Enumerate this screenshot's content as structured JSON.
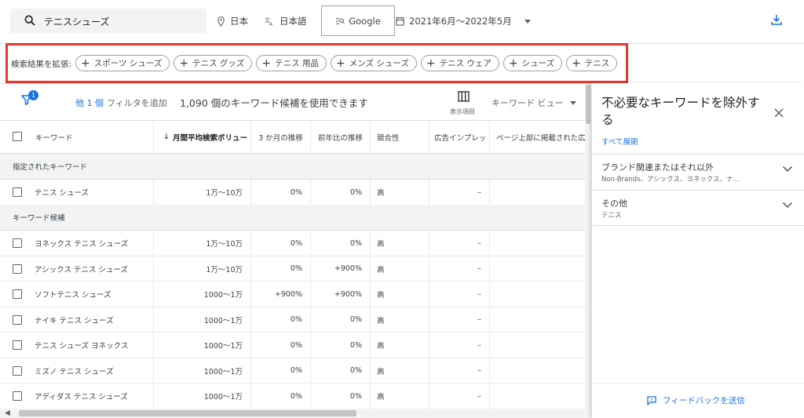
{
  "topbar": {
    "search_value": "テニスシューズ",
    "location": "日本",
    "language": "日本語",
    "engine": "Google",
    "date_range": "2021年6月〜2022年5月"
  },
  "expand": {
    "label": "検索結果を拡張:",
    "chips": [
      "スポーツ シューズ",
      "テニス グッズ",
      "テニス 用品",
      "メンズ シューズ",
      "テニス ウェア",
      "シューズ",
      "テニス"
    ]
  },
  "toolbar": {
    "filter_badge": "1",
    "filters_count": "他 1 個",
    "add_filter": "フィルタを追加",
    "candidates": "1,090 個のキーワード候補を使用できます",
    "columns_label": "表示項目",
    "view": "キーワード ビュー"
  },
  "table": {
    "headers": [
      "キーワード",
      "月間平均検索ボリュー",
      "3 か月の推移",
      "前年比の推移",
      "競合性",
      "広告インプレッ",
      "ページ上部に掲載された広"
    ],
    "section_specified": "指定されたキーワード",
    "specified_rows": [
      {
        "keyword": "テニス シューズ",
        "volume": "1万～10万",
        "three_month": "0%",
        "yoy": "0%",
        "competition": "高",
        "impr": "–"
      }
    ],
    "section_candidates": "キーワード候補",
    "candidate_rows": [
      {
        "keyword": "ヨネックス テニス シューズ",
        "volume": "1万～10万",
        "three_month": "0%",
        "yoy": "0%",
        "competition": "高",
        "impr": "–"
      },
      {
        "keyword": "アシックス テニス シューズ",
        "volume": "1万～10万",
        "three_month": "0%",
        "yoy": "+900%",
        "competition": "高",
        "impr": "–"
      },
      {
        "keyword": "ソフトテニス シューズ",
        "volume": "1000～1万",
        "three_month": "+900%",
        "yoy": "+900%",
        "competition": "高",
        "impr": "–"
      },
      {
        "keyword": "ナイキ テニス シューズ",
        "volume": "1000～1万",
        "three_month": "0%",
        "yoy": "0%",
        "competition": "高",
        "impr": "–"
      },
      {
        "keyword": "テニス シューズ ヨネックス",
        "volume": "1000～1万",
        "three_month": "0%",
        "yoy": "0%",
        "competition": "高",
        "impr": "–"
      },
      {
        "keyword": "ミズノ テニス シューズ",
        "volume": "1000～1万",
        "three_month": "0%",
        "yoy": "0%",
        "competition": "高",
        "impr": "–"
      },
      {
        "keyword": "アディダス テニス シューズ",
        "volume": "1000～1万",
        "three_month": "0%",
        "yoy": "0%",
        "competition": "高",
        "impr": "–"
      }
    ]
  },
  "panel": {
    "title": "不必要なキーワードを除外する",
    "expand_all": "すべて展開",
    "sections": [
      {
        "title": "ブランド関連またはそれ以外",
        "subtitle": "Non-Brands、アシックス、ヨネックス、ナ..."
      },
      {
        "title": "その他",
        "subtitle": "テニス"
      }
    ],
    "feedback": "フィードバックを送信"
  }
}
